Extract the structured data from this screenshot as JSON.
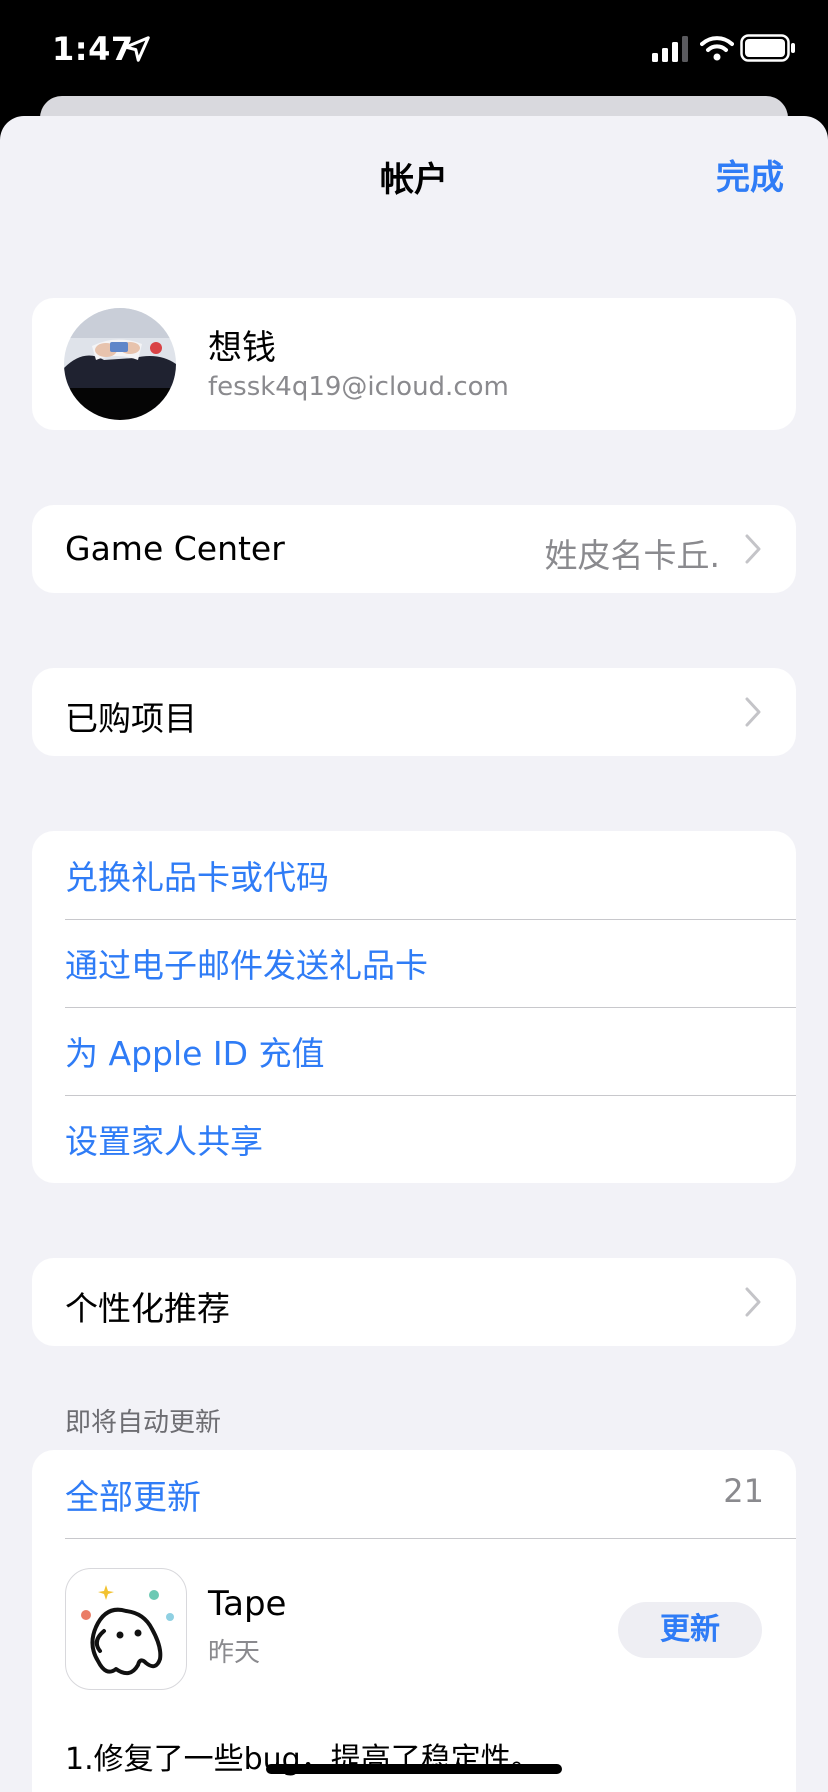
{
  "status_bar": {
    "time": "1:47"
  },
  "nav": {
    "title": "帐户",
    "done_label": "完成"
  },
  "profile": {
    "name": "想钱",
    "email": "fessk4q19@icloud.com"
  },
  "game_center": {
    "label": "Game Center",
    "value": "姓皮名卡丘."
  },
  "purchased": {
    "label": "已购项目"
  },
  "links": [
    {
      "label": "兑换礼品卡或代码"
    },
    {
      "label": "通过电子邮件发送礼品卡"
    },
    {
      "label": "为 Apple ID 充值"
    },
    {
      "label": "设置家人共享"
    }
  ],
  "personalized": {
    "label": "个性化推荐"
  },
  "updates": {
    "section_header": "即将自动更新",
    "update_all_label": "全部更新",
    "count": "21",
    "apps": [
      {
        "name": "Tape",
        "date": "昨天",
        "button_label": "更新",
        "notes": "1.修复了一些bug，提高了稳定性。"
      }
    ]
  },
  "colors": {
    "accent": "#2f7cf6",
    "background": "#f2f2f7",
    "card": "#ffffff",
    "secondary_text": "#8a8a8e"
  }
}
